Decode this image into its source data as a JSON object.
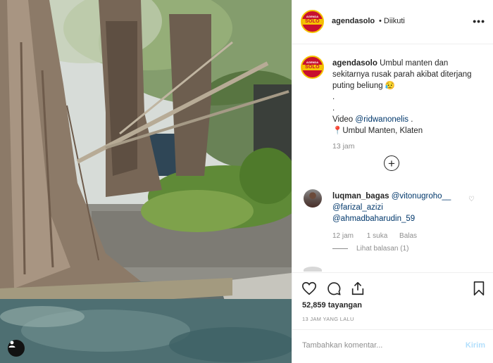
{
  "header": {
    "username": "agendasolo",
    "follow_status": "• Diikuti",
    "avatar_logo_top": "AGENDA",
    "avatar_logo_band": "SOLO",
    "more_label": "•••"
  },
  "caption": {
    "username": "agendasolo",
    "text": "Umbul manten dan sekitarnya rusak parah akibat diterjang puting beliung 😥",
    "dot1": ".",
    "dot2": ".",
    "video_prefix": "Video",
    "video_tag": "@ridwanonelis",
    "video_suffix": ".",
    "location": "📍Umbul Manten, Klaten",
    "time": "13 jam",
    "load_more": "+"
  },
  "reply": {
    "username": "luqman_bagas",
    "mention1": "@vitonugroho__",
    "mention2": "@farizal_azizi",
    "mention3": "@ahmadbaharudin_59",
    "time": "12 jam",
    "likes": "1 suka",
    "reply_label": "Balas",
    "view_replies": "Lihat balasan (1)"
  },
  "actions": {
    "icons": [
      "heart-icon",
      "comment-icon",
      "share-icon",
      "bookmark-icon"
    ],
    "views": "52,859 tayangan",
    "posted_ago": "13 JAM YANG LALU"
  },
  "comment_box": {
    "placeholder": "Tambahkan komentar...",
    "post_label": "Kirim"
  },
  "colors": {
    "link": "#00376b",
    "muted": "#8e8e8e",
    "post_button_disabled": "#b2dffc",
    "brand_red": "#c8102e",
    "brand_yellow": "#f5c400"
  }
}
